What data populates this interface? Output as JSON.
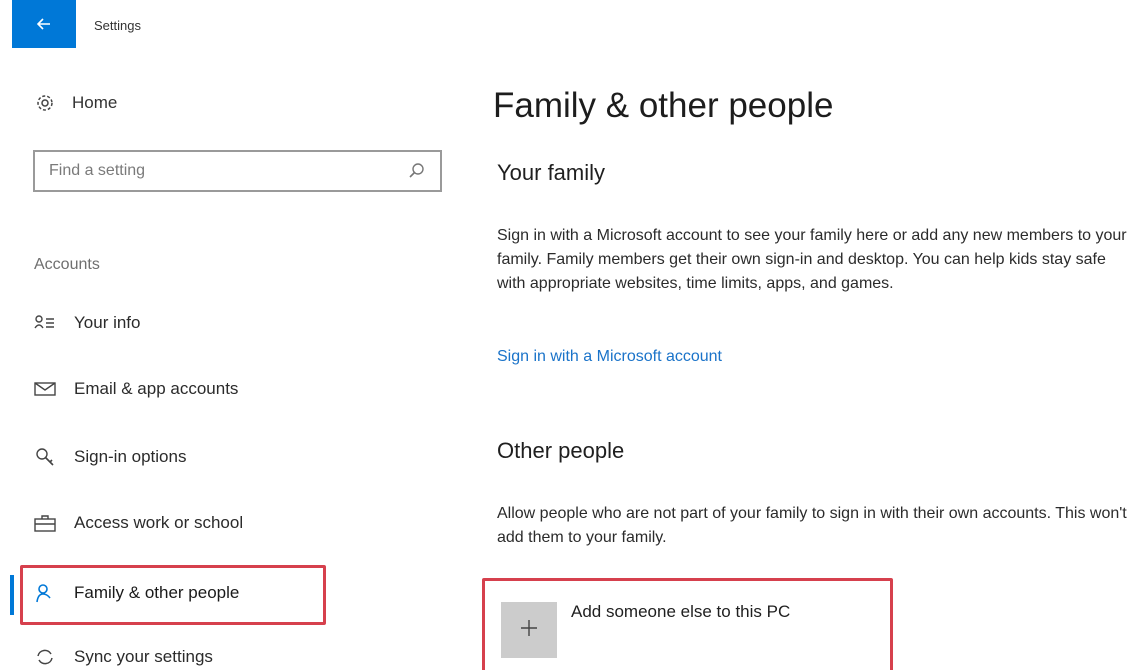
{
  "window": {
    "title": "Settings",
    "back_icon": "back-arrow-icon"
  },
  "sidebar": {
    "home_label": "Home",
    "search_placeholder": "Find a setting",
    "section_label": "Accounts",
    "items": [
      {
        "label": "Your info",
        "icon": "person-card-icon"
      },
      {
        "label": "Email & app accounts",
        "icon": "mail-icon"
      },
      {
        "label": "Sign-in options",
        "icon": "key-icon"
      },
      {
        "label": "Access work or school",
        "icon": "briefcase-icon"
      },
      {
        "label": "Family & other people",
        "icon": "person-icon",
        "selected": true
      },
      {
        "label": "Sync your settings",
        "icon": "sync-icon"
      }
    ]
  },
  "main": {
    "title": "Family & other people",
    "family": {
      "heading": "Your family",
      "description": "Sign in with a Microsoft account to see your family here or add any new members to your family. Family members get their own sign-in and desktop. You can help kids stay safe with appropriate websites, time limits, apps, and games.",
      "link": "Sign in with a Microsoft account"
    },
    "other": {
      "heading": "Other people",
      "description": "Allow people who are not part of your family to sign in with their own accounts. This won't add them to your family.",
      "add_label": "Add someone else to this PC"
    }
  },
  "colors": {
    "accent": "#0078d7",
    "highlight": "#d6404d",
    "link": "#1a73c9"
  }
}
